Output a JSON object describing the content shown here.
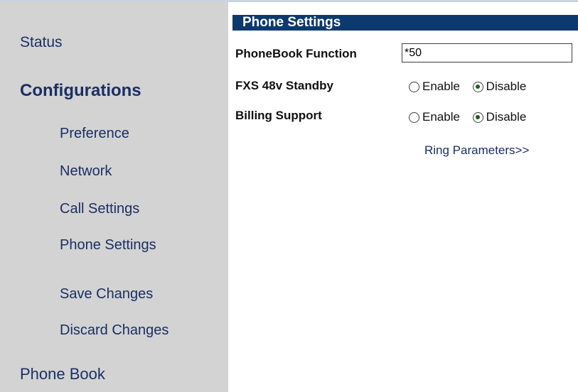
{
  "sidebar": {
    "status": "Status",
    "configurations": "Configurations",
    "items": [
      "Preference",
      "Network",
      "Call Settings",
      "Phone Settings"
    ],
    "save_changes": "Save Changes",
    "discard_changes": "Discard Changes",
    "phone_book": "Phone Book"
  },
  "main": {
    "section_title": "Phone Settings",
    "phonebook_function": {
      "label": "PhoneBook Function",
      "value": "*50"
    },
    "fxs_standby": {
      "label": "FXS 48v Standby",
      "enable_label": "Enable",
      "disable_label": "Disable",
      "selected": "Disable"
    },
    "billing_support": {
      "label": "Billing Support",
      "enable_label": "Enable",
      "disable_label": "Disable",
      "selected": "Disable"
    },
    "ring_parameters_link": "Ring Parameters>>"
  },
  "colors": {
    "sidebar_bg": "#d3d3d3",
    "link_text": "#1a2f63",
    "header_bg": "#0d3a6e",
    "header_text": "#ffffff"
  }
}
